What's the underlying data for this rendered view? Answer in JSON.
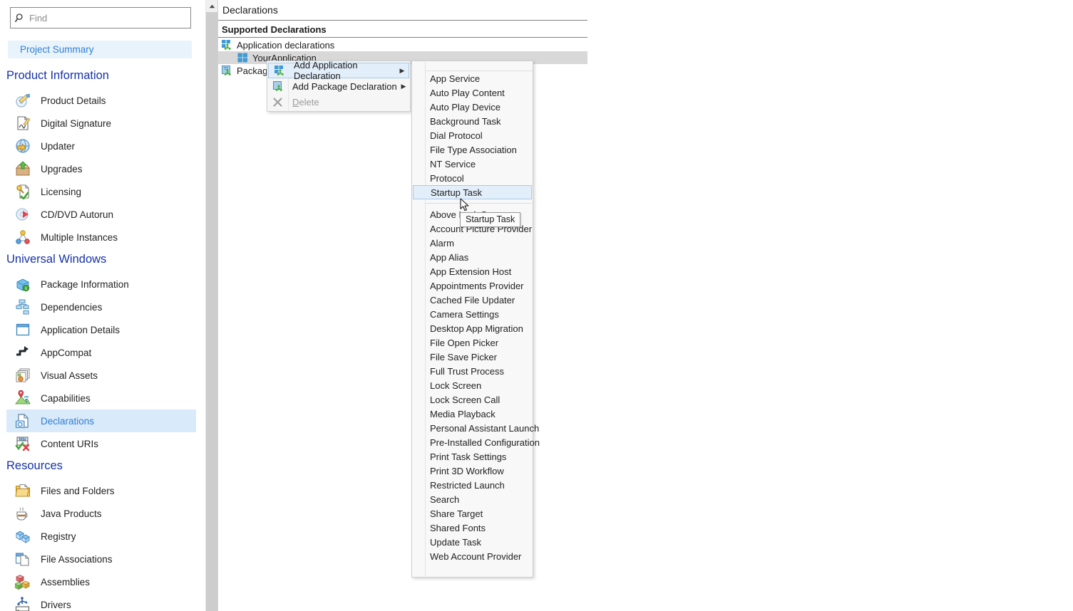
{
  "sidebar": {
    "search": {
      "placeholder": "Find",
      "value": "",
      "icon": "search-icon"
    },
    "project_summary": "Project Summary",
    "sections": [
      {
        "title": "Product Information",
        "items": [
          {
            "label": "Product Details",
            "icon": "product-details-icon"
          },
          {
            "label": "Digital Signature",
            "icon": "digital-signature-icon"
          },
          {
            "label": "Updater",
            "icon": "updater-icon"
          },
          {
            "label": "Upgrades",
            "icon": "upgrades-icon"
          },
          {
            "label": "Licensing",
            "icon": "licensing-icon"
          },
          {
            "label": "CD/DVD Autorun",
            "icon": "cd-dvd-autorun-icon"
          },
          {
            "label": "Multiple Instances",
            "icon": "multiple-instances-icon"
          }
        ]
      },
      {
        "title": "Universal Windows",
        "items": [
          {
            "label": "Package Information",
            "icon": "package-information-icon"
          },
          {
            "label": "Dependencies",
            "icon": "dependencies-icon"
          },
          {
            "label": "Application Details",
            "icon": "application-details-icon"
          },
          {
            "label": "AppCompat",
            "icon": "appcompat-icon"
          },
          {
            "label": "Visual Assets",
            "icon": "visual-assets-icon"
          },
          {
            "label": "Capabilities",
            "icon": "capabilities-icon"
          },
          {
            "label": "Declarations",
            "icon": "declarations-icon",
            "selected": true
          },
          {
            "label": "Content URIs",
            "icon": "content-uris-icon"
          }
        ]
      },
      {
        "title": "Resources",
        "items": [
          {
            "label": "Files and Folders",
            "icon": "files-and-folders-icon"
          },
          {
            "label": "Java Products",
            "icon": "java-products-icon"
          },
          {
            "label": "Registry",
            "icon": "registry-icon"
          },
          {
            "label": "File Associations",
            "icon": "file-associations-icon"
          },
          {
            "label": "Assemblies",
            "icon": "assemblies-icon"
          },
          {
            "label": "Drivers",
            "icon": "drivers-icon"
          }
        ]
      }
    ]
  },
  "main": {
    "panel_title": "Declarations",
    "sub_title": "Supported Declarations",
    "tree": [
      {
        "label": "Application declarations",
        "icon": "application-declarations-icon",
        "indent": 0,
        "selected": false
      },
      {
        "label": "YourApplication",
        "icon": "windows-app-icon",
        "indent": 1,
        "selected": true
      },
      {
        "label": "Package declarations",
        "icon": "package-declarations-icon",
        "indent": 0,
        "selected": false
      }
    ]
  },
  "context_menu": {
    "items": [
      {
        "label": "Add Application Declaration",
        "icon": "add-application-declaration-icon",
        "submenu": true,
        "highlighted": true,
        "disabled": false
      },
      {
        "label": "Add Package Declaration",
        "icon": "add-package-declaration-icon",
        "submenu": true,
        "highlighted": false,
        "disabled": false
      },
      {
        "label": "Delete",
        "accel": "D",
        "icon": "delete-x-icon",
        "submenu": false,
        "highlighted": false,
        "disabled": true
      }
    ]
  },
  "submenu": {
    "group_a": [
      "App Service",
      "Auto Play Content",
      "Auto Play Device",
      "Background Task",
      "Dial Protocol",
      "File Type Association",
      "NT Service",
      "Protocol",
      "Startup Task"
    ],
    "highlighted": "Startup Task",
    "group_b": [
      "Above Lock Screen",
      "Account Picture Provider",
      "Alarm",
      "App Alias",
      "App Extension Host",
      "Appointments Provider",
      "Cached File Updater",
      "Camera Settings",
      "Desktop App Migration",
      "File Open Picker",
      "File Save Picker",
      "Full Trust Process",
      "Lock Screen",
      "Lock Screen Call",
      "Media Playback",
      "Personal Assistant Launch",
      "Pre-Installed Configuration",
      "Print Task Settings",
      "Print 3D Workflow",
      "Restricted Launch",
      "Search",
      "Share Target",
      "Shared Fonts",
      "Update Task",
      "Web Account Provider"
    ]
  },
  "tooltip": {
    "text": "Startup Task"
  },
  "colors": {
    "accent_blue": "#2f7fd4",
    "section_heading": "#1633a6",
    "selection_bg": "#d9eafa",
    "menu_highlight_bg": "#e3eefb",
    "menu_highlight_border": "#a8c9e8",
    "tree_selection_bg": "#d8d8d8",
    "scrollbar_thumb": "#cdcdcd"
  }
}
